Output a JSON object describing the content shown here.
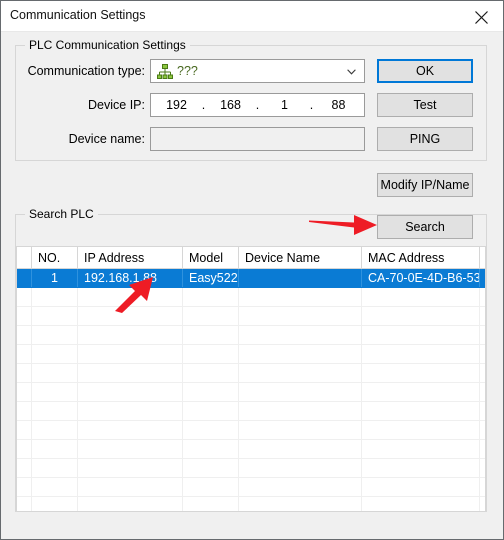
{
  "window": {
    "title": "Communication Settings",
    "close_icon": "close-icon"
  },
  "plc_group": {
    "title": "PLC Communication Settings",
    "fields": {
      "comm_type": {
        "label": "Communication type:",
        "icon": "network-tree-icon",
        "value": "???"
      },
      "device_ip": {
        "label": "Device IP:",
        "octets": [
          "192",
          "168",
          "1",
          "88"
        ],
        "separator": "."
      },
      "device_name": {
        "label": "Device name:",
        "value": "",
        "placeholder": ""
      }
    },
    "buttons": {
      "ok": "OK",
      "test": "Test",
      "ping": "PING"
    }
  },
  "modify_button": "Modify IP/Name",
  "search_group": {
    "title": "Search PLC",
    "search_button": "Search",
    "table": {
      "columns": [
        "NO.",
        "IP Address",
        "Model",
        "Device Name",
        "MAC Address"
      ],
      "rows": [
        {
          "no": "1",
          "ip_address": "192.168.1.88",
          "model": "Easy522",
          "device_name": "",
          "mac_address": "CA-70-0E-4D-B6-53",
          "selected": true
        }
      ],
      "empty_row_count": 13
    }
  },
  "annotations": [
    {
      "name": "arrow-to-search-button",
      "direction": "right",
      "color": "#ee1c25"
    },
    {
      "name": "arrow-to-ip-address-cell",
      "direction": "up-right",
      "color": "#ee1c25"
    }
  ],
  "colors": {
    "selection": "#0a7bd4",
    "focus_border": "#0078d7",
    "annotation_red": "#ee1c25",
    "combo_text_green": "#4a6a22",
    "dialog_bg": "#f0f0f0"
  }
}
